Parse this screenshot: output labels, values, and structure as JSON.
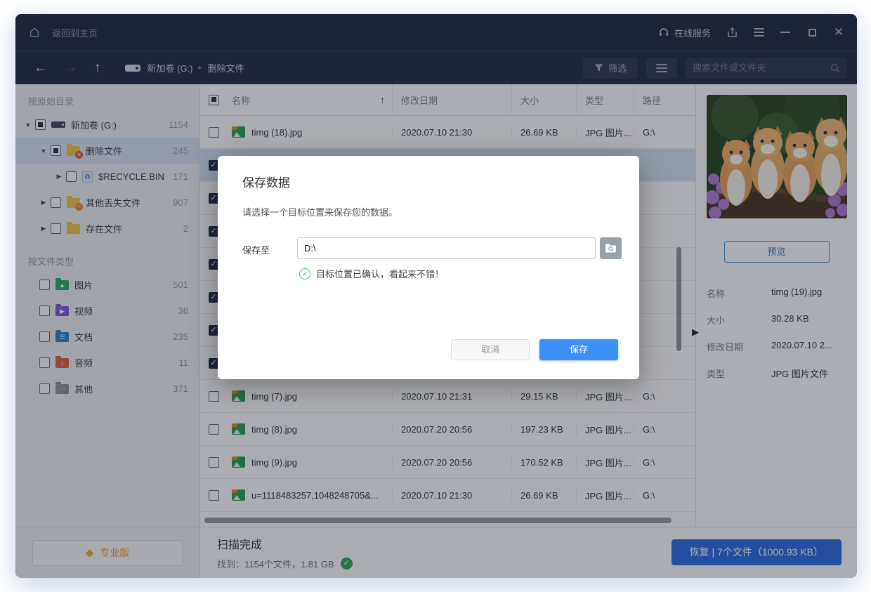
{
  "titlebar": {
    "home_label": "返回到主页",
    "online_service": "在线服务"
  },
  "toolbar": {
    "breadcrumb_drive": "新加卷 (G:)",
    "breadcrumb_folder": "删除文件",
    "filter_label": "筛选",
    "search_placeholder": "搜索文件或文件夹"
  },
  "sidebar": {
    "section_directory": "按原始目录",
    "section_filetype": "按文件类型",
    "tree": [
      {
        "label": "新加卷 (G:)",
        "count": "1154",
        "level": 0,
        "arrow": "expanded",
        "checkbox": "partial",
        "icon": "drive",
        "selected": false
      },
      {
        "label": "删除文件",
        "count": "245",
        "level": 1,
        "arrow": "expanded",
        "checkbox": "partial",
        "icon": "folder-deleted",
        "selected": true
      },
      {
        "label": "$RECYCLE.BIN",
        "count": "171",
        "level": 2,
        "arrow": "collapsed",
        "checkbox": "unchecked",
        "icon": "recycle-bin",
        "selected": false
      },
      {
        "label": "其他丢失文件",
        "count": "907",
        "level": 1,
        "arrow": "collapsed",
        "checkbox": "unchecked",
        "icon": "folder-lost",
        "selected": false
      },
      {
        "label": "存在文件",
        "count": "2",
        "level": 1,
        "arrow": "collapsed",
        "checkbox": "unchecked",
        "icon": "folder",
        "selected": false
      }
    ],
    "types": [
      {
        "label": "图片",
        "count": "501",
        "icon": "image-folder",
        "color": "#2fae67",
        "glyph": "▲"
      },
      {
        "label": "视频",
        "count": "36",
        "icon": "video-folder",
        "color": "#7b5bd6",
        "glyph": "▶"
      },
      {
        "label": "文档",
        "count": "235",
        "icon": "document-folder",
        "color": "#2f86c8",
        "glyph": "☰"
      },
      {
        "label": "音频",
        "count": "11",
        "icon": "audio-folder",
        "color": "#e0634a",
        "glyph": "♪"
      },
      {
        "label": "其他",
        "count": "371",
        "icon": "other-folder",
        "color": "#8a949e",
        "glyph": "⋯"
      }
    ],
    "pro_button": "专业版"
  },
  "filelist": {
    "columns": {
      "name": "名称",
      "date": "修改日期",
      "size": "大小",
      "type": "类型",
      "path": "路径"
    },
    "rows": [
      {
        "name": "timg (18).jpg",
        "date": "2020.07.10 21:30",
        "size": "26.69 KB",
        "type": "JPG 图片...",
        "path": "G:\\",
        "checked": false,
        "selected": false,
        "covered": false
      },
      {
        "name": "",
        "date": "",
        "size": "",
        "type": "",
        "path": "",
        "checked": true,
        "selected": true,
        "covered": true
      },
      {
        "name": "",
        "date": "",
        "size": "",
        "type": "",
        "path": "",
        "checked": true,
        "selected": false,
        "covered": true
      },
      {
        "name": "",
        "date": "",
        "size": "",
        "type": "",
        "path": "",
        "checked": true,
        "selected": false,
        "covered": true
      },
      {
        "name": "",
        "date": "",
        "size": "",
        "type": "",
        "path": "",
        "checked": true,
        "selected": false,
        "covered": true
      },
      {
        "name": "",
        "date": "",
        "size": "",
        "type": "",
        "path": "",
        "checked": true,
        "selected": false,
        "covered": true
      },
      {
        "name": "",
        "date": "",
        "size": "",
        "type": "",
        "path": "",
        "checked": true,
        "selected": false,
        "covered": true
      },
      {
        "name": "",
        "date": "",
        "size": "",
        "type": "",
        "path": "",
        "checked": true,
        "selected": false,
        "covered": true
      },
      {
        "name": "timg (7).jpg",
        "date": "2020.07.10 21:31",
        "size": "29.15 KB",
        "type": "JPG 图片...",
        "path": "G:\\",
        "checked": false,
        "selected": false,
        "covered": false
      },
      {
        "name": "timg (8).jpg",
        "date": "2020.07.20 20:56",
        "size": "197.23 KB",
        "type": "JPG 图片...",
        "path": "G:\\",
        "checked": false,
        "selected": false,
        "covered": false
      },
      {
        "name": "timg (9).jpg",
        "date": "2020.07.20 20:56",
        "size": "170.52 KB",
        "type": "JPG 图片...",
        "path": "G:\\",
        "checked": false,
        "selected": false,
        "covered": false
      },
      {
        "name": "u=1118483257,1048248705&...",
        "date": "2020.07.10 21:30",
        "size": "26.69 KB",
        "type": "JPG 图片...",
        "path": "G:\\",
        "checked": false,
        "selected": false,
        "covered": false
      }
    ]
  },
  "preview": {
    "button": "预览",
    "details": [
      {
        "label": "名称",
        "value": "timg (19).jpg"
      },
      {
        "label": "大小",
        "value": "30.28 KB"
      },
      {
        "label": "修改日期",
        "value": "2020.07.10 2..."
      },
      {
        "label": "类型",
        "value": "JPG 图片文件"
      }
    ]
  },
  "statusbar": {
    "title": "扫描完成",
    "found": "找到：1154个文件，1.81 GB",
    "recover_button": "恢复 | 7个文件（1000.93 KB）"
  },
  "dialog": {
    "title": "保存数据",
    "description": "请选择一个目标位置来保存您的数据。",
    "save_to_label": "保存至",
    "path_value": "D:\\",
    "confirm_message": "目标位置已确认，看起来不错！",
    "cancel": "取消",
    "save": "保存"
  },
  "colors": {
    "accent": "#3e8ef7",
    "green": "#35a854",
    "orange": "#f0a732",
    "titlebar": "#262d44"
  }
}
